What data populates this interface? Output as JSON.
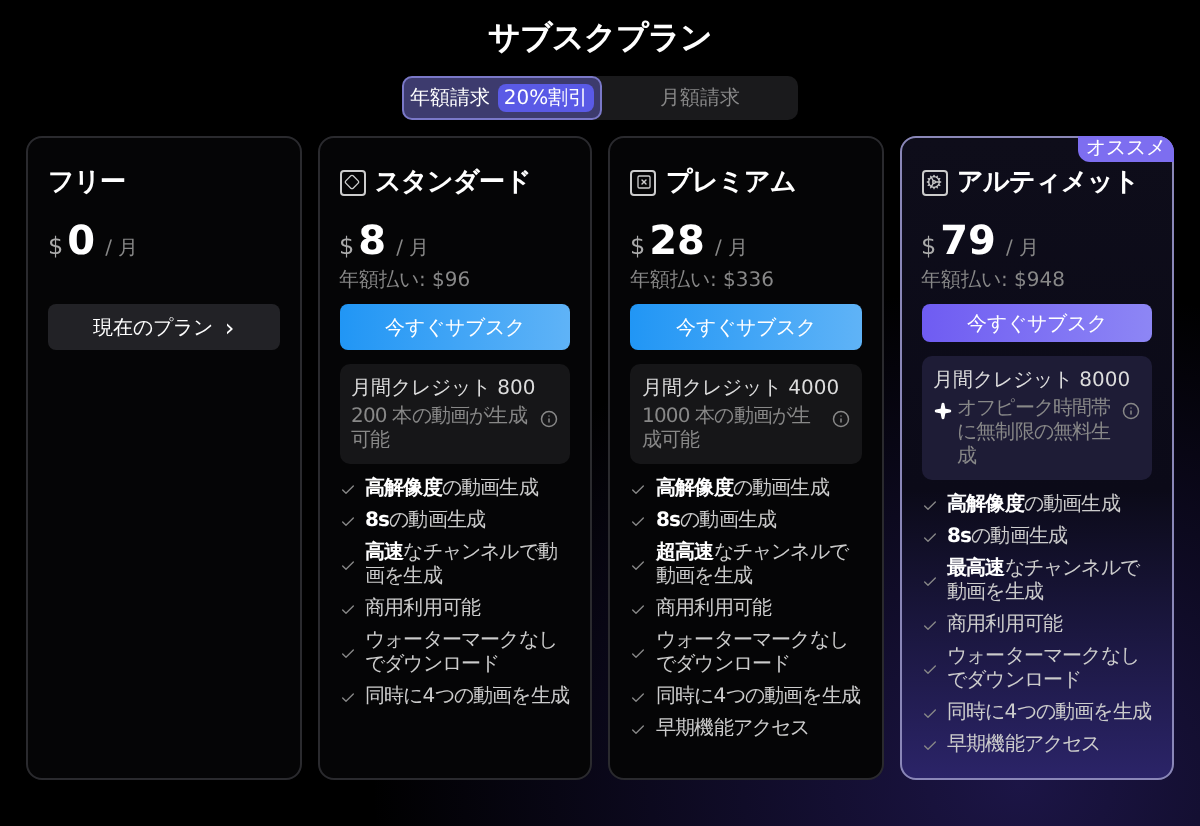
{
  "title": "サブスクプラン",
  "billing_tabs": [
    {
      "label": "年額請求",
      "badge": "20%割引",
      "selected": true
    },
    {
      "label": "月額請求",
      "selected": false
    }
  ],
  "plans": [
    {
      "name": "フリー",
      "has_icon": false,
      "highlighted": false,
      "currency": "$",
      "price": "0",
      "period": "/ 月",
      "button": {
        "kind": "current",
        "label": "現在のプラン",
        "chevron": "›"
      }
    },
    {
      "name": "スタンダード",
      "has_icon": true,
      "highlighted": false,
      "currency": "$",
      "price": "8",
      "period": "/ 月",
      "annual": "年額払い: $96",
      "button": {
        "kind": "subscribe",
        "label": "今すぐサブスク"
      },
      "credit": {
        "title": "月間クレジット 800",
        "note": "200 本の動画が生成可能",
        "sparkle": false
      },
      "features": [
        "**高解像度**の動画生成",
        "**8s**の動画生成",
        "**高速**なチャンネルで動画を生成",
        "商用利用可能",
        "ウォーターマークなしでダウンロード",
        "同時に4つの動画を生成"
      ]
    },
    {
      "name": "プレミアム",
      "has_icon": true,
      "highlighted": false,
      "currency": "$",
      "price": "28",
      "period": "/ 月",
      "annual": "年額払い: $336",
      "button": {
        "kind": "subscribe",
        "label": "今すぐサブスク"
      },
      "credit": {
        "title": "月間クレジット 4000",
        "note": "1000 本の動画が生成可能",
        "sparkle": false
      },
      "features": [
        "**高解像度**の動画生成",
        "**8s**の動画生成",
        "**超高速**なチャンネルで動画を生成",
        "商用利用可能",
        "ウォーターマークなしでダウンロード",
        "同時に4つの動画を生成",
        "早期機能アクセス"
      ]
    },
    {
      "name": "アルティメット",
      "has_icon": true,
      "highlighted": true,
      "recommend": "オススメ",
      "currency": "$",
      "price": "79",
      "period": "/ 月",
      "annual": "年額払い: $948",
      "button": {
        "kind": "subscribe",
        "label": "今すぐサブスク"
      },
      "credit": {
        "title": "月間クレジット 8000",
        "note": "オフピーク時間帯に無制限の無料生成",
        "sparkle": true
      },
      "features": [
        "**高解像度**の動画生成",
        "**8s**の動画生成",
        "**最高速**なチャンネルで動画を生成",
        "商用利用可能",
        "ウォーターマークなしでダウンロード",
        "同時に4つの動画を生成",
        "早期機能アクセス"
      ]
    }
  ]
}
